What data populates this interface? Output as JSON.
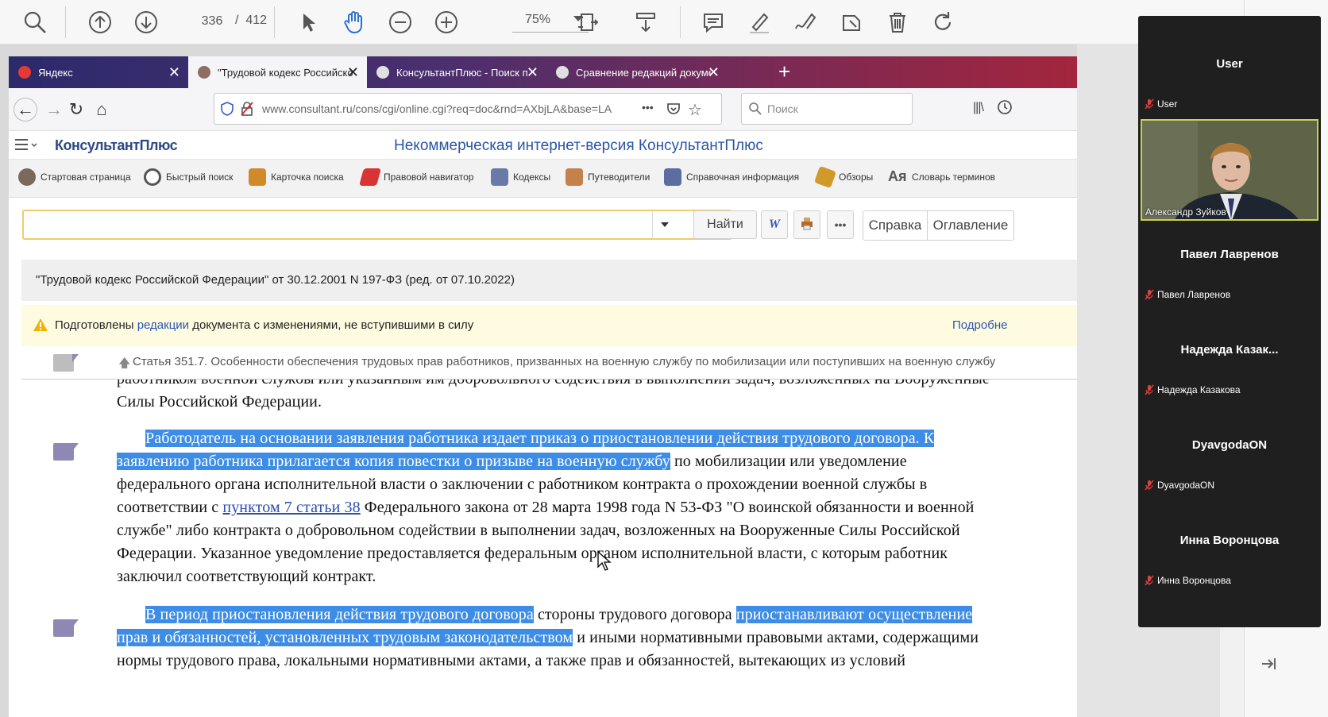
{
  "pdf_toolbar": {
    "page_current": "336",
    "page_separator": "/",
    "page_total": "412",
    "zoom": "75%"
  },
  "browser": {
    "tabs": [
      {
        "title": "Яндекс",
        "fav_color": "#e53935",
        "active": false
      },
      {
        "title": "\"Трудовой кодекс Российско",
        "fav_color": "#8d6e63",
        "active": true
      },
      {
        "title": "КонсультантПлюс - Поиск п",
        "fav_color": "#e0e0e0",
        "active": false
      },
      {
        "title": "Сравнение редакций докуме",
        "fav_color": "#e0e0e0",
        "active": false
      }
    ],
    "new_tab": "+",
    "url": "www.consultant.ru/cons/cgi/online.cgi?req=doc&rnd=AXbjLA&base=LA",
    "url_more": "•••",
    "search_placeholder": "Поиск"
  },
  "consultant": {
    "logo": "КонсультантПлюс",
    "header_title": "Некоммерческая интернет-версия КонсультантПлюс",
    "toolbar": [
      {
        "label": "Стартовая страница",
        "icon": "home-figure-icon",
        "color": "#7a6a5c"
      },
      {
        "label": "Быстрый поиск",
        "icon": "search-icon",
        "color": "#555"
      },
      {
        "label": "Карточка поиска",
        "icon": "search-card-icon",
        "color": "#d08a2a"
      },
      {
        "label": "Правовой навигатор",
        "icon": "navigator-icon",
        "color": "#d93434"
      },
      {
        "label": "Кодексы",
        "icon": "codex-icon",
        "color": "#6a7aa8"
      },
      {
        "label": "Путеводители",
        "icon": "guide-icon",
        "color": "#c4814a"
      },
      {
        "label": "Справочная информация",
        "icon": "reference-icon",
        "color": "#5c6ea0"
      },
      {
        "label": "Обзоры",
        "icon": "reviews-icon",
        "color": "#d09a2a"
      },
      {
        "label": "Словарь терминов",
        "icon": "dictionary-icon",
        "color": "#6a6a9a"
      }
    ],
    "find_button": "Найти",
    "word_button": "W",
    "more_button": "•••",
    "help_button": "Справка",
    "contents_button": "Оглавление",
    "doc_title": "\"Трудовой кодекс Российской Федерации\" от 30.12.2001 N 197-ФЗ (ред. от 07.10.2022)",
    "warning": {
      "before": "Подготовлены ",
      "link": "редакции",
      "after": " документа с изменениями, не вступившими в силу",
      "more": "Подробне"
    },
    "article": "Статья 351.7. Особенности обеспечения трудовых прав работников, призванных на военную службу по мобилизации или поступивших на военную службу",
    "body_lines": [
      [
        {
          "t": "работником военной службы или указанным им добровольного содействия в выполнении задач, возложенных на Вооруженные"
        }
      ],
      [
        {
          "t": "Силы Российской Федерации."
        }
      ],
      [
        {
          "t": "Работодатель на основании заявления работника издает приказ о приостановлении действия трудового договора. К",
          "hl": true
        }
      ],
      [
        {
          "t": "заявлению работника прилагается копия повестки о призыве на военную службу",
          "hl": true
        },
        {
          "t": " по мобилизации или уведомление"
        }
      ],
      [
        {
          "t": "федерального органа исполнительной власти о заключении с работником контракта о прохождении военной службы в"
        }
      ],
      [
        {
          "t": "соответствии с "
        },
        {
          "t": "пунктом 7 статьи 38",
          "link": true
        },
        {
          "t": " Федерального закона от 28 марта 1998 года N 53-ФЗ \"О воинской обязанности и военной"
        }
      ],
      [
        {
          "t": "службе\" либо контракта о добровольном содействии в выполнении задач, возложенных на Вооруженные Силы Российской"
        }
      ],
      [
        {
          "t": "Федерации. Указанное уведомление предоставляется федеральным органом исполнительной власти, с которым работник"
        }
      ],
      [
        {
          "t": "заключил соответствующий контракт."
        }
      ],
      [
        {
          "t": "В период приостановления действия трудового договора",
          "hl": true
        },
        {
          "t": " стороны трудового договора "
        },
        {
          "t": "приостанавливают осуществление",
          "hl": true
        }
      ],
      [
        {
          "t": "прав и обязанностей, установленных трудовым законодательством",
          "hl": true
        },
        {
          "t": " и иными нормативными правовыми актами, содержащими"
        }
      ],
      [
        {
          "t": "нормы трудового права, локальными нормативными актами, а также прав и обязанностей, вытекающих из условий"
        }
      ]
    ]
  },
  "video_call": {
    "participants": [
      {
        "big": "User",
        "small": "User"
      },
      {
        "big": "",
        "small": "Александр Зуйков"
      },
      {
        "big": "Павел Лавренов",
        "small": "Павел Лавренов"
      },
      {
        "big": "Надежда  Казак...",
        "small": "Надежда Казакова"
      },
      {
        "big": "DyavgodaON",
        "small": "DyavgodaON"
      },
      {
        "big": "Инна Воронцова",
        "small": "Инна Воронцова"
      }
    ]
  }
}
